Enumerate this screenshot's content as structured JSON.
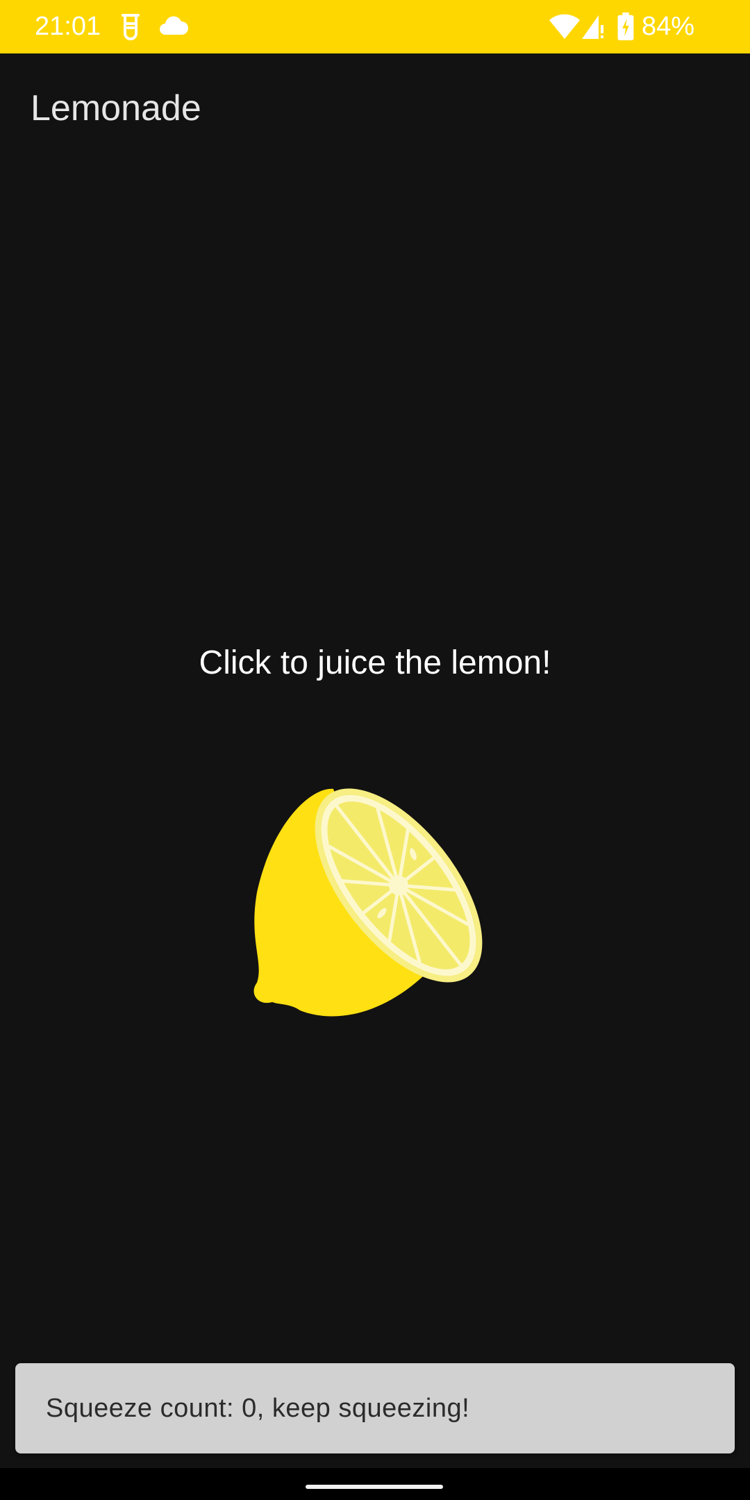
{
  "status_bar": {
    "time": "21:01",
    "battery": "84%",
    "icons": [
      "beaker-icon",
      "cloud-icon",
      "wifi-icon",
      "signal-icon",
      "battery-charging-icon"
    ],
    "background_color": "#FFD700"
  },
  "app": {
    "title": "Lemonade",
    "background_color": "#121212"
  },
  "main": {
    "instruction": "Click to juice the lemon!",
    "image_icon": "lemon-squeeze-icon"
  },
  "snackbar": {
    "message": "Squeeze count: 0, keep squeezing!"
  }
}
